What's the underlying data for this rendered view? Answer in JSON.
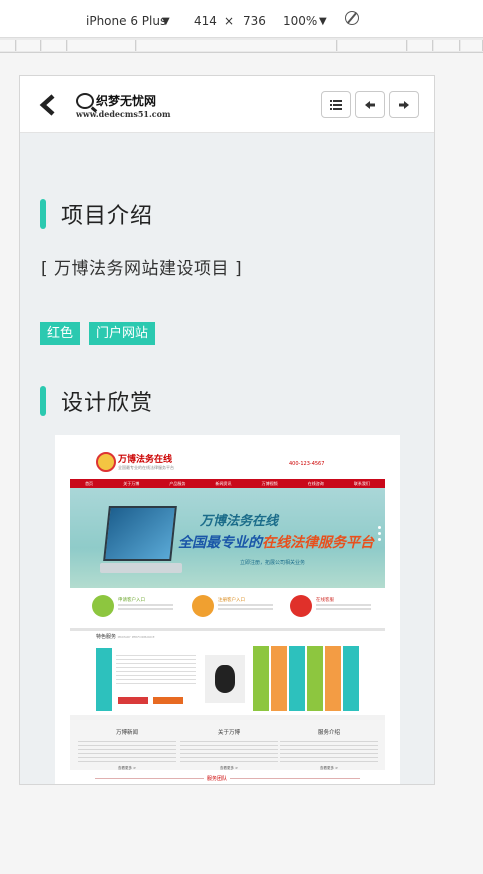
{
  "devtools": {
    "device": "iPhone 6 Plus",
    "device_caret": "▼",
    "width": "414",
    "times": "×",
    "height": "736",
    "zoom": "100%",
    "zoom_caret": "▼",
    "icons": [
      "rotate-icon"
    ]
  },
  "header": {
    "logo_name": "织梦无忧网",
    "logo_url": "www.dedecms51.com",
    "icons": [
      "back-chevron-icon",
      "menu-list-icon",
      "arrow-left-icon",
      "arrow-right-icon"
    ]
  },
  "project": {
    "section_title": "项目介绍",
    "name": "[ 万博法务网站建设项目 ]",
    "tags": [
      "红色",
      "门户网站"
    ]
  },
  "design": {
    "section_title": "设计欣赏"
  },
  "preview": {
    "site_title": "万博法务在线",
    "site_sub": "全国最专业的在线法律服务平台",
    "phone": "400-123-4567",
    "nav": [
      "首页",
      "关于万博",
      "产品服务",
      "新闻资讯",
      "万博视频",
      "在线咨询",
      "联系我们"
    ],
    "banner_line1": "万博法务在线",
    "banner_line2_a": "全国最专业的",
    "banner_line2_b": "在线法律服务平台",
    "banner_line3": "立即注册，拓展公司相关业务",
    "entries": [
      "申请客户入口",
      "注册客户入口",
      "在线客服"
    ],
    "feature_title": "特色服务",
    "feature_title_en": "PRIMARY PERFORMANCE",
    "lower_titles": [
      "万博新闻",
      "关于万博",
      "服务介绍"
    ],
    "more": "查看更多 >",
    "team": "服务团队"
  },
  "colors": {
    "accent": "#2bc9b0",
    "preview_red": "#c9081a",
    "feature_columns": [
      "#8dc63f",
      "#f39c44",
      "#2dc1bd",
      "#8dc63f",
      "#f39c44",
      "#2dc1bd"
    ]
  }
}
